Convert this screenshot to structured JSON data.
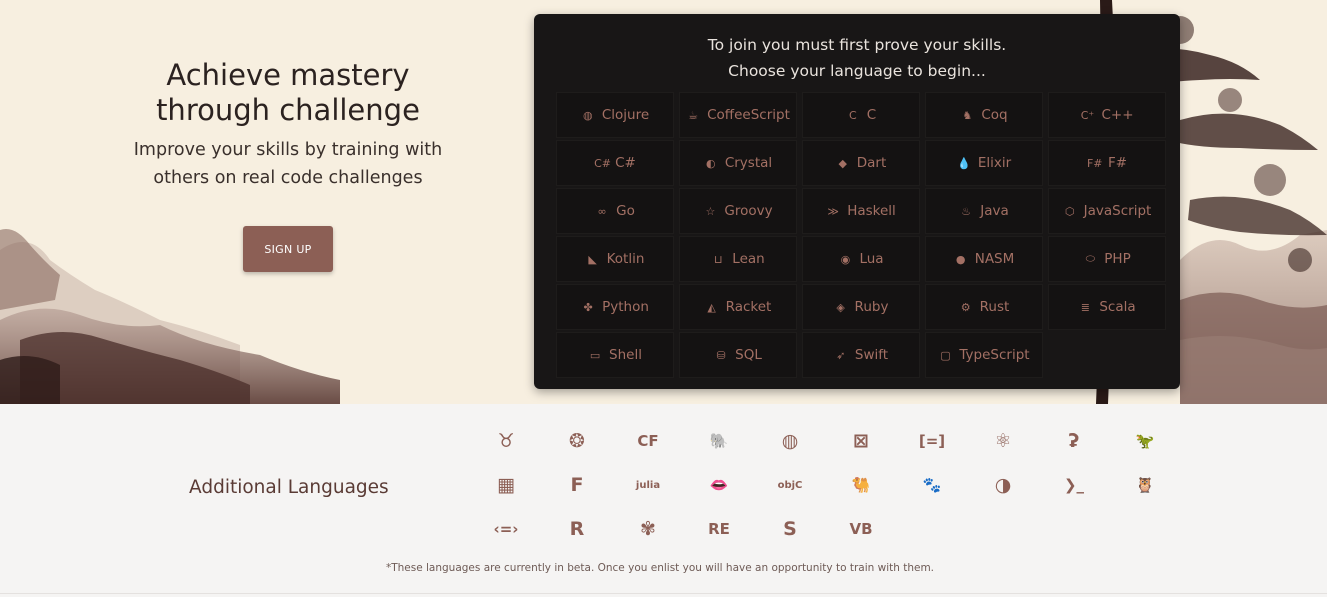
{
  "hero": {
    "title_line1": "Achieve mastery",
    "title_line2": "through challenge",
    "subtitle_line1": "Improve your skills by training with",
    "subtitle_line2": "others on real code challenges",
    "signup_label": "SIGN UP",
    "accent_color": "#8c5f55"
  },
  "panel": {
    "heading_line1": "To join you must first prove your skills.",
    "heading_line2": "Choose your language to begin...",
    "languages": [
      {
        "label": "Clojure",
        "icon": "clojure-icon",
        "glyph": "◍"
      },
      {
        "label": "CoffeeScript",
        "icon": "coffeescript-icon",
        "glyph": "☕"
      },
      {
        "label": "C",
        "icon": "c-icon",
        "glyph": "C"
      },
      {
        "label": "Coq",
        "icon": "coq-icon",
        "glyph": "♞"
      },
      {
        "label": "C++",
        "icon": "cpp-icon",
        "glyph": "C⁺"
      },
      {
        "label": "C#",
        "icon": "csharp-icon",
        "glyph": "C#"
      },
      {
        "label": "Crystal",
        "icon": "crystal-icon",
        "glyph": "◐"
      },
      {
        "label": "Dart",
        "icon": "dart-icon",
        "glyph": "◆"
      },
      {
        "label": "Elixir",
        "icon": "elixir-icon",
        "glyph": "💧"
      },
      {
        "label": "F#",
        "icon": "fsharp-icon",
        "glyph": "F#"
      },
      {
        "label": "Go",
        "icon": "go-icon",
        "glyph": "∞"
      },
      {
        "label": "Groovy",
        "icon": "groovy-icon",
        "glyph": "☆"
      },
      {
        "label": "Haskell",
        "icon": "haskell-icon",
        "glyph": "≫"
      },
      {
        "label": "Java",
        "icon": "java-icon",
        "glyph": "♨"
      },
      {
        "label": "JavaScript",
        "icon": "javascript-icon",
        "glyph": "⬡"
      },
      {
        "label": "Kotlin",
        "icon": "kotlin-icon",
        "glyph": "◣"
      },
      {
        "label": "Lean",
        "icon": "lean-icon",
        "glyph": "⊔"
      },
      {
        "label": "Lua",
        "icon": "lua-icon",
        "glyph": "◉"
      },
      {
        "label": "NASM",
        "icon": "nasm-icon",
        "glyph": "●"
      },
      {
        "label": "PHP",
        "icon": "php-icon",
        "glyph": "⬭"
      },
      {
        "label": "Python",
        "icon": "python-icon",
        "glyph": "✤"
      },
      {
        "label": "Racket",
        "icon": "racket-icon",
        "glyph": "◭"
      },
      {
        "label": "Ruby",
        "icon": "ruby-icon",
        "glyph": "◈"
      },
      {
        "label": "Rust",
        "icon": "rust-icon",
        "glyph": "⚙"
      },
      {
        "label": "Scala",
        "icon": "scala-icon",
        "glyph": "≣"
      },
      {
        "label": "Shell",
        "icon": "shell-icon",
        "glyph": "▭"
      },
      {
        "label": "SQL",
        "icon": "sql-icon",
        "glyph": "⛁"
      },
      {
        "label": "Swift",
        "icon": "swift-icon",
        "glyph": "➶"
      },
      {
        "label": "TypeScript",
        "icon": "typescript-icon",
        "glyph": "▢"
      }
    ]
  },
  "additional": {
    "title": "Additional Languages",
    "icons": [
      {
        "name": "agda-icon",
        "glyph": "♉"
      },
      {
        "name": "bf-icon",
        "glyph": "❂"
      },
      {
        "name": "cfml-icon",
        "glyph": "CF"
      },
      {
        "name": "cobol-icon",
        "glyph": "🐘"
      },
      {
        "name": "commonlisp-icon",
        "glyph": "◍"
      },
      {
        "name": "d-icon",
        "glyph": "⊠"
      },
      {
        "name": "erlang-icon",
        "glyph": "[=]"
      },
      {
        "name": "factor-icon",
        "glyph": "⚛"
      },
      {
        "name": "forth-icon",
        "glyph": "ʡ"
      },
      {
        "name": "fortran-icon",
        "glyph": "🦖"
      },
      {
        "name": "idris-icon",
        "glyph": "▦"
      },
      {
        "name": "fantom-icon",
        "glyph": "F"
      },
      {
        "name": "julia-icon",
        "glyph": "julia"
      },
      {
        "name": "lambdacalc-icon",
        "glyph": "👄"
      },
      {
        "name": "objc-icon",
        "glyph": "objC"
      },
      {
        "name": "ocaml-icon",
        "glyph": "🐫"
      },
      {
        "name": "pascal-icon",
        "glyph": "🐾"
      },
      {
        "name": "perl-icon",
        "glyph": "◑"
      },
      {
        "name": "powershell-icon",
        "glyph": "❯_"
      },
      {
        "name": "prolog-icon",
        "glyph": "🦉"
      },
      {
        "name": "purescript-icon",
        "glyph": "‹=›"
      },
      {
        "name": "r-icon",
        "glyph": "R"
      },
      {
        "name": "reason-icon",
        "glyph": "✾"
      },
      {
        "name": "riscv-icon",
        "glyph": "RE"
      },
      {
        "name": "solidity-icon",
        "glyph": "S"
      },
      {
        "name": "vb-icon",
        "glyph": "VB"
      }
    ],
    "beta_note": "*These languages are currently in beta. Once you enlist you will have an opportunity to train with them."
  }
}
